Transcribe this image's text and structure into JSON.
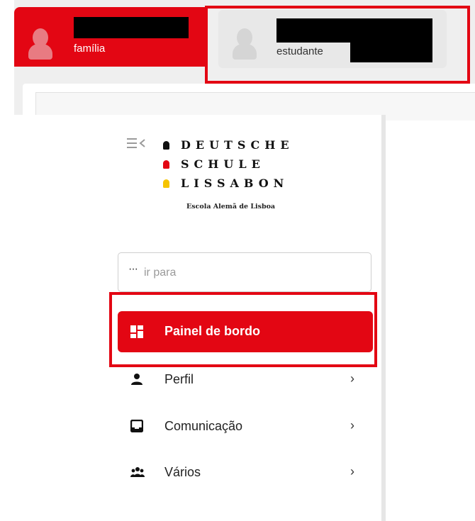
{
  "accounts": {
    "familia": {
      "role_label": "família",
      "active": true
    },
    "estudante": {
      "role_label": "estudante",
      "active": false
    }
  },
  "logo": {
    "line1": "DEUTSCHE",
    "line2": "SCHULE",
    "line3": "LISSABON",
    "subtitle": "Escola Alemã de Lisboa",
    "mark_colors": [
      "#111111",
      "#e30613",
      "#f5c400"
    ]
  },
  "search": {
    "prefix": "···",
    "placeholder": "ir para"
  },
  "nav": {
    "items": [
      {
        "label": "Painel de bordo",
        "icon": "dashboard-icon",
        "active": true
      },
      {
        "label": "Perfil",
        "icon": "person-icon",
        "chevron": "›"
      },
      {
        "label": "Comunicação",
        "icon": "inbox-icon",
        "chevron": "›"
      },
      {
        "label": "Vários",
        "icon": "group-icon",
        "chevron": "›"
      }
    ]
  },
  "colors": {
    "accent": "#e30613",
    "highlight_outline": "#e30613"
  }
}
